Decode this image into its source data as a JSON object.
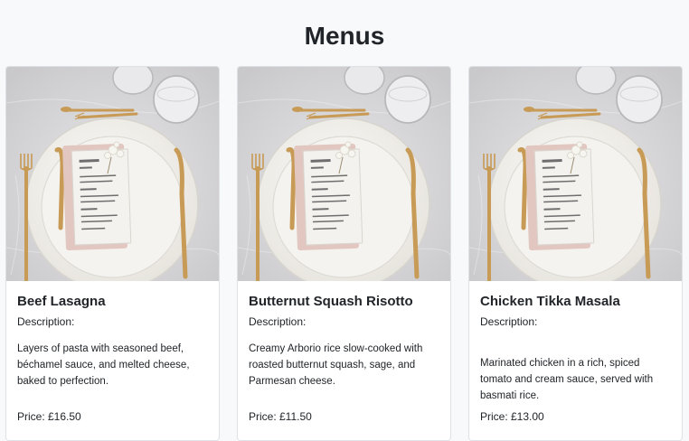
{
  "page": {
    "title": "Menus"
  },
  "menu_items": [
    {
      "name": "Beef Lasagna",
      "description_label": "Description:",
      "description": "Layers of pasta with seasoned beef, béchamel sauce, and melted cheese, baked to perfection.",
      "price": "Price: £16.50",
      "image_icon": "place-setting-photo"
    },
    {
      "name": "Butternut Squash Risotto",
      "description_label": "Description:",
      "description": "Creamy Arborio rice slow-cooked with roasted butternut squash, sage, and Parmesan cheese.",
      "price": "Price: £11.50",
      "image_icon": "place-setting-photo"
    },
    {
      "name": "Chicken Tikka Masala",
      "description_label": "Description:",
      "description": "Marinated chicken in a rich, spiced tomato and cream sauce, served with basmati rice.",
      "price": "Price: £13.00",
      "image_icon": "place-setting-photo"
    }
  ],
  "colors": {
    "background": "#f8f9fa",
    "card_border": "#dee2e6",
    "text": "#212529",
    "gold_cutlery": "#c79a55"
  }
}
